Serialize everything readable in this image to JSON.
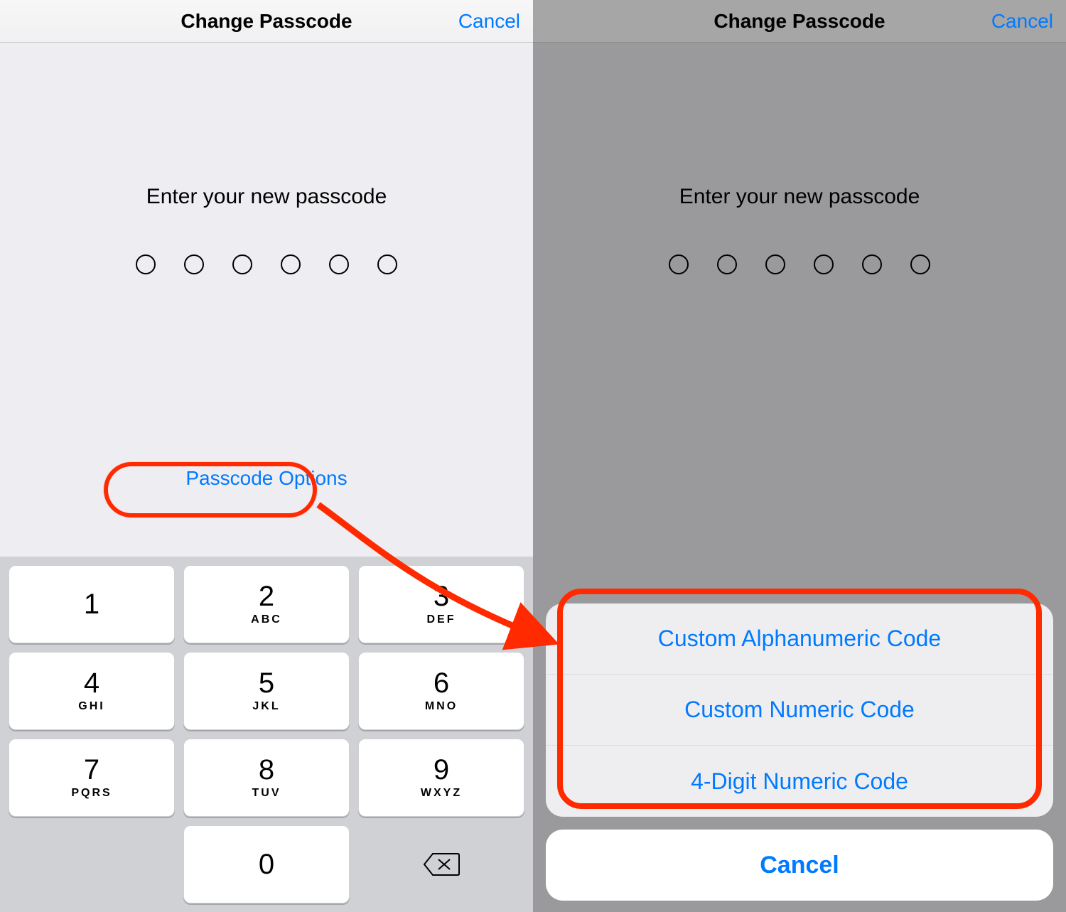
{
  "left": {
    "title": "Change Passcode",
    "cancel": "Cancel",
    "prompt": "Enter your new passcode",
    "options_link": "Passcode Options",
    "keypad": [
      {
        "num": "1",
        "sub": ""
      },
      {
        "num": "2",
        "sub": "ABC"
      },
      {
        "num": "3",
        "sub": "DEF"
      },
      {
        "num": "4",
        "sub": "GHI"
      },
      {
        "num": "5",
        "sub": "JKL"
      },
      {
        "num": "6",
        "sub": "MNO"
      },
      {
        "num": "7",
        "sub": "PQRS"
      },
      {
        "num": "8",
        "sub": "TUV"
      },
      {
        "num": "9",
        "sub": "WXYZ"
      },
      {
        "num": "",
        "sub": ""
      },
      {
        "num": "0",
        "sub": ""
      },
      {
        "num": "",
        "sub": ""
      }
    ]
  },
  "right": {
    "title": "Change Passcode",
    "cancel": "Cancel",
    "prompt": "Enter your new passcode",
    "sheet": {
      "items": [
        "Custom Alphanumeric Code",
        "Custom Numeric Code",
        "4-Digit Numeric Code"
      ],
      "cancel": "Cancel"
    }
  }
}
